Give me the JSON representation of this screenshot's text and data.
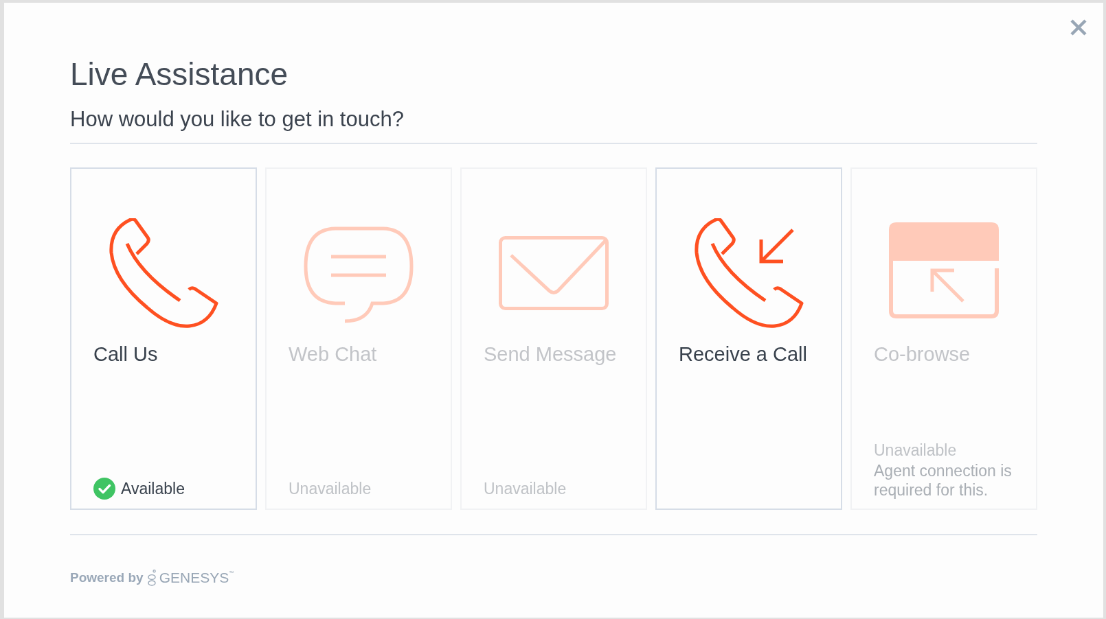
{
  "dialog": {
    "title": "Live Assistance",
    "subtitle": "How would you like to get in touch?"
  },
  "options": [
    {
      "kind": "call",
      "label": "Call Us",
      "disabled": false,
      "status": "Available"
    },
    {
      "kind": "chat",
      "label": "Web Chat",
      "disabled": true,
      "status": "Unavailable"
    },
    {
      "kind": "message",
      "label": "Send Message",
      "disabled": true,
      "status": "Unavailable"
    },
    {
      "kind": "callback",
      "label": "Receive a Call",
      "disabled": false
    },
    {
      "kind": "cobrowse",
      "label": "Co-browse",
      "disabled": true,
      "status": "Unavailable",
      "note": "Agent connection is required for this."
    }
  ],
  "footer": {
    "powered_by": "Powered by",
    "brand": "GENESYS$^{™}$"
  }
}
